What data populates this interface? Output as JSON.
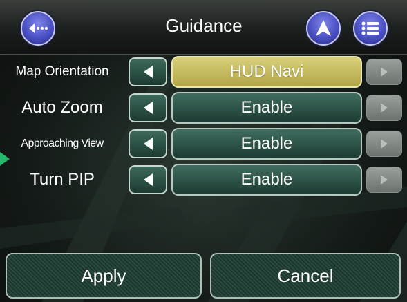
{
  "header": {
    "title": "Guidance",
    "back_icon": "back-ellipsis-icon",
    "navigation_icon": "navigation-arrow-icon",
    "menu_icon": "menu-list-icon"
  },
  "settings": [
    {
      "label": "Map Orientation",
      "value": "HUD Navi",
      "active": true
    },
    {
      "label": "Auto Zoom",
      "value": "Enable",
      "active": false
    },
    {
      "label": "Approaching View",
      "value": "Enable",
      "active": false
    },
    {
      "label": "Turn PIP",
      "value": "Enable",
      "active": false
    }
  ],
  "footer": {
    "apply_label": "Apply",
    "cancel_label": "Cancel"
  },
  "colors": {
    "accent_blue": "#4a50c4",
    "active_value": "#d9d07a",
    "row_green": "#2e5448",
    "marker_green": "#27b86e"
  }
}
